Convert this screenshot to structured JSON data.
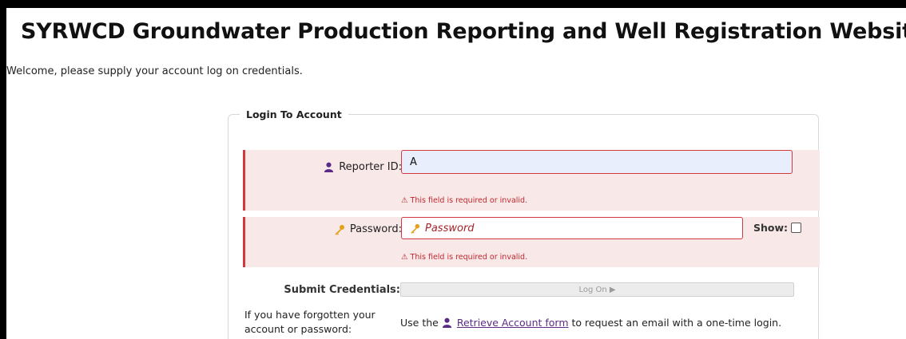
{
  "page": {
    "title": "SYRWCD Groundwater Production Reporting and Well Registration Website",
    "welcome": "Welcome, please supply your account log on credentials."
  },
  "login": {
    "legend": "Login To Account",
    "reporter_id_label": "Reporter ID:",
    "reporter_id_value": "A",
    "reporter_id_error": "⚠ This field is required or invalid.",
    "password_label": "Password:",
    "password_placeholder": "Password",
    "password_error": "⚠ This field is required or invalid.",
    "show_label": "Show:",
    "submit_label": "Submit Credentials:",
    "logon_button": "Log On ▶",
    "forgot_text": "If you have forgotten your account or password:",
    "retrieve_prefix": "Use the",
    "retrieve_link": "Retrieve Account form",
    "retrieve_suffix": "to request an email with a one-time login."
  },
  "icons": {
    "user": "user-icon",
    "key": "key-icon",
    "user_color": "#5b2a86",
    "key_color": "#e3a21a",
    "error_color": "#d0393f"
  }
}
